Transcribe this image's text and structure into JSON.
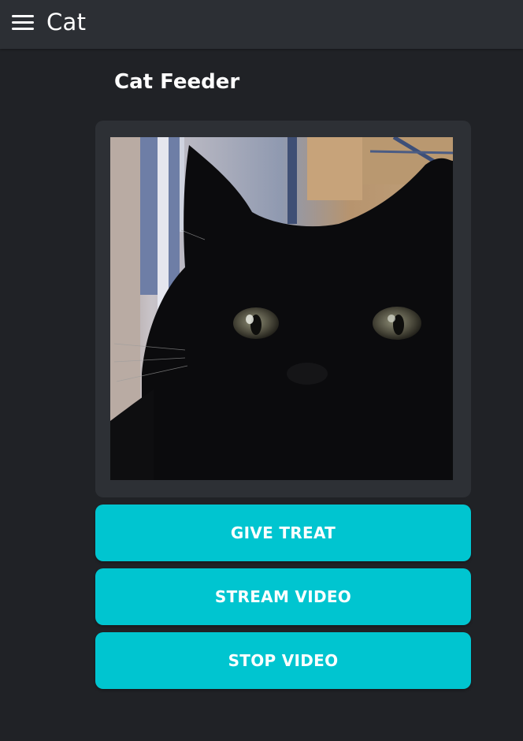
{
  "app_bar": {
    "menu_icon": "hamburger-menu-icon",
    "title": "Cat"
  },
  "main": {
    "page_title": "Cat Feeder",
    "video": {
      "content": "live-camera-feed"
    },
    "buttons": {
      "give_treat": "GIVE TREAT",
      "stream_video": "STREAM VIDEO",
      "stop_video": "STOP VIDEO"
    }
  },
  "colors": {
    "background": "#202226",
    "app_bar": "#2c2f34",
    "card": "#2d3035",
    "accent": "#00c5d0",
    "text": "#ffffff"
  }
}
